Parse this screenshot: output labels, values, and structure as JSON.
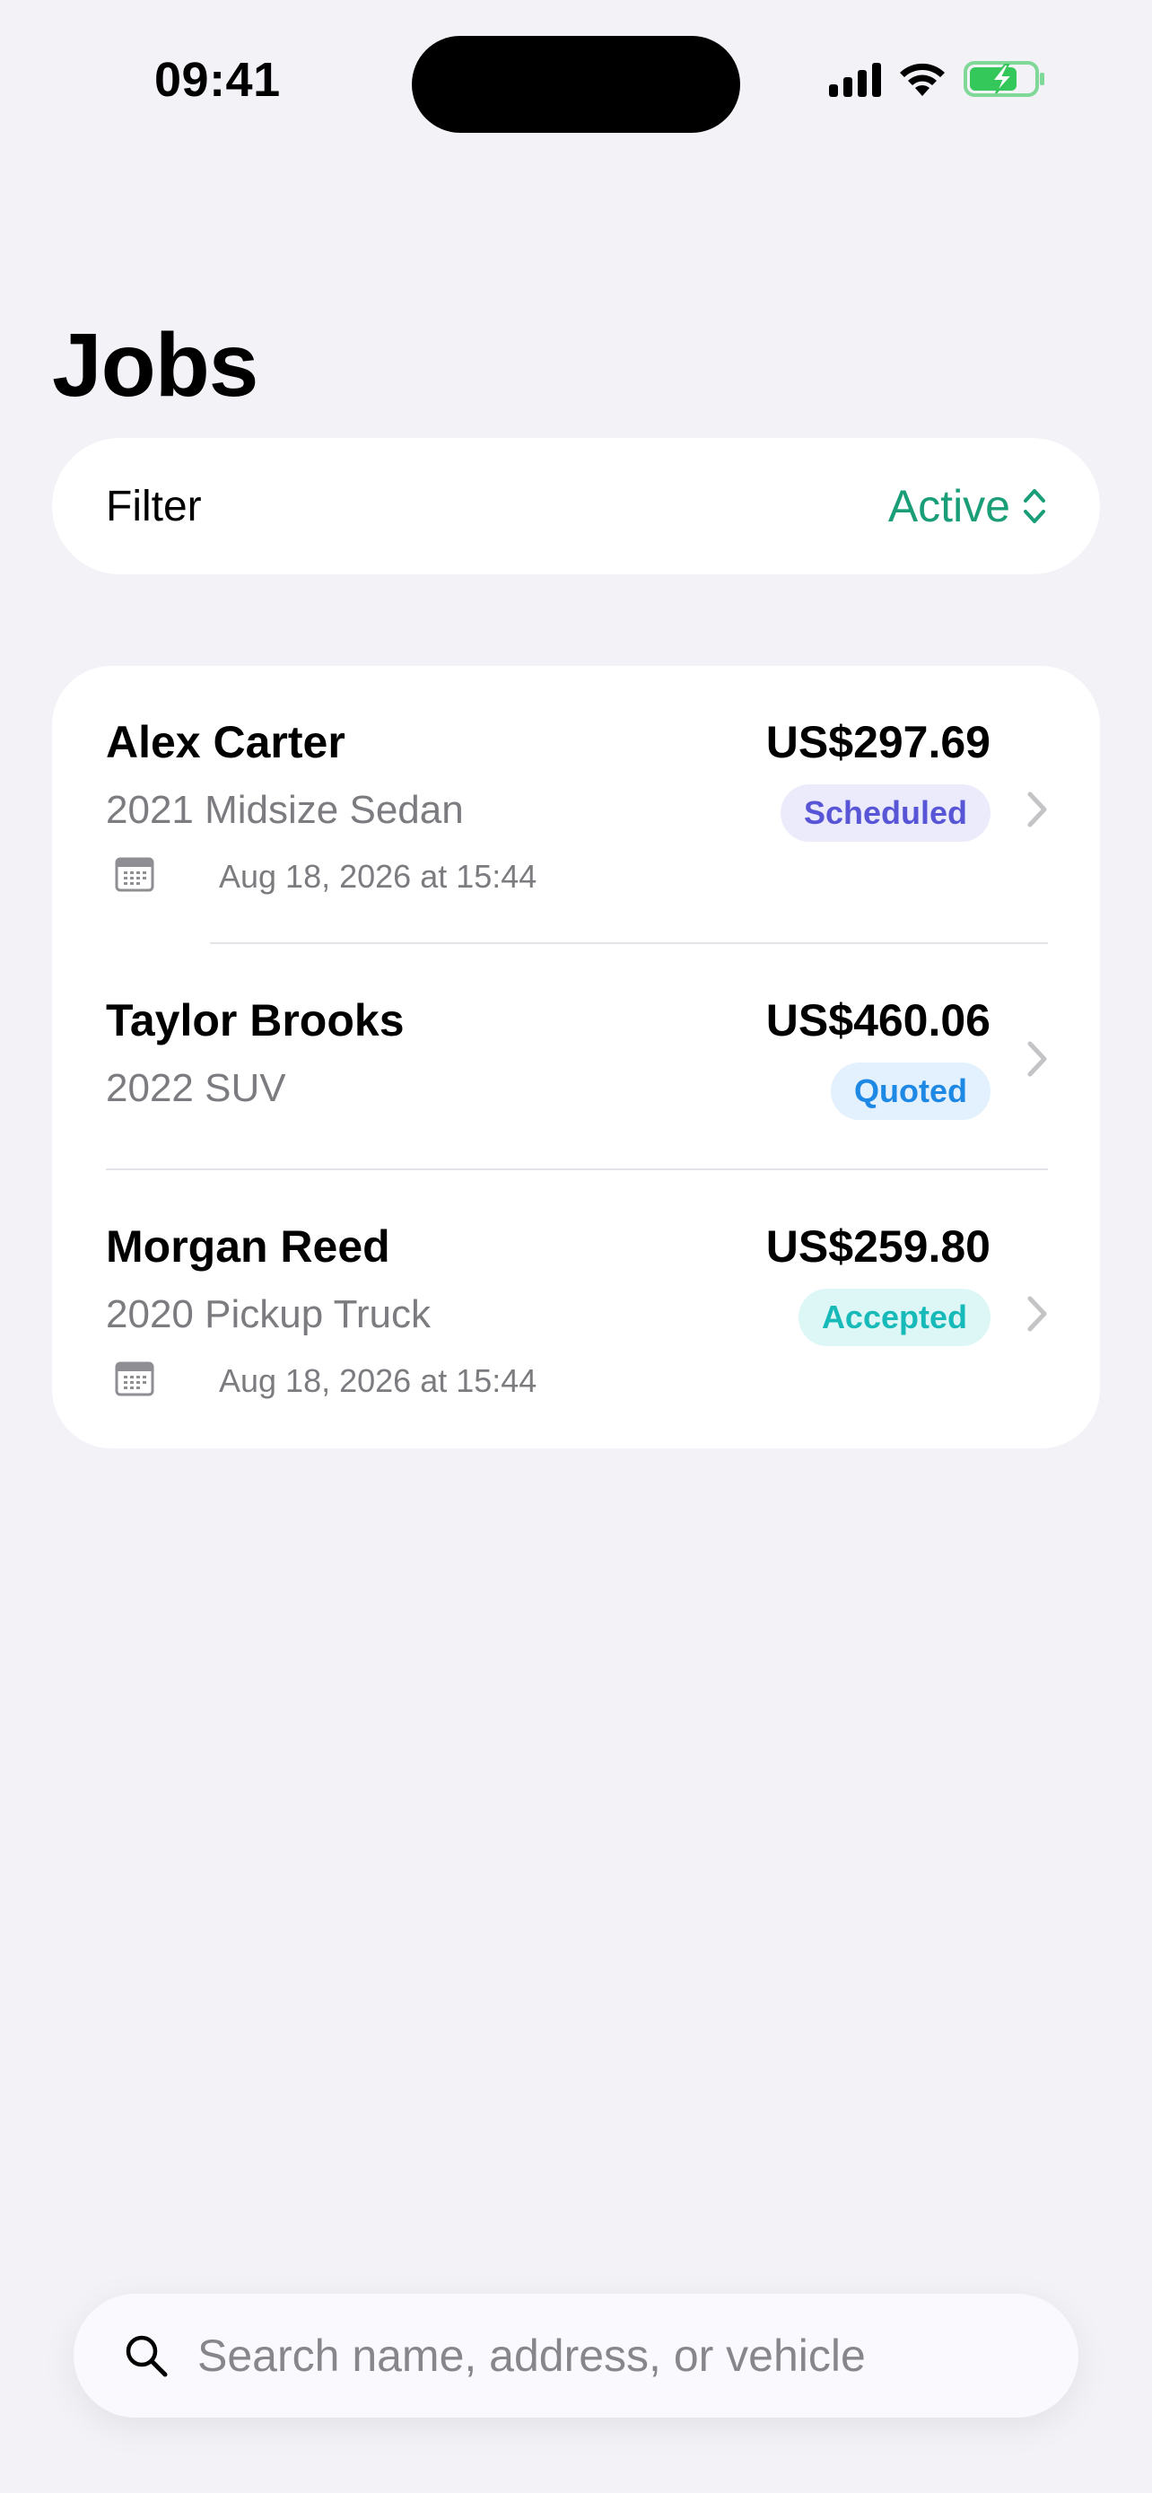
{
  "status_bar": {
    "time": "09:41"
  },
  "header": {
    "title": "Jobs"
  },
  "filter": {
    "label": "Filter",
    "value": "Active"
  },
  "jobs": [
    {
      "name": "Alex Carter",
      "vehicle": "2021 Midsize Sedan",
      "price": "US$297.69",
      "status": "Scheduled",
      "status_color": "#5856D6",
      "status_bg": "#EBEBFB",
      "date": "Aug 18, 2026 at 15:44"
    },
    {
      "name": "Taylor Brooks",
      "vehicle": "2022 SUV",
      "price": "US$460.06",
      "status": "Quoted",
      "status_color": "#1E88E5",
      "status_bg": "#E3F0FD"
    },
    {
      "name": "Morgan Reed",
      "vehicle": "2020 Pickup Truck",
      "price": "US$259.80",
      "status": "Accepted",
      "status_color": "#18B9B9",
      "status_bg": "#DDF7F6",
      "date": "Aug 18, 2026 at 15:44"
    }
  ],
  "search": {
    "placeholder": "Search name, address, or vehicle"
  },
  "colors": {
    "accent": "#1A9E78",
    "background": "#F2F2F7",
    "battery": "#34C759"
  }
}
